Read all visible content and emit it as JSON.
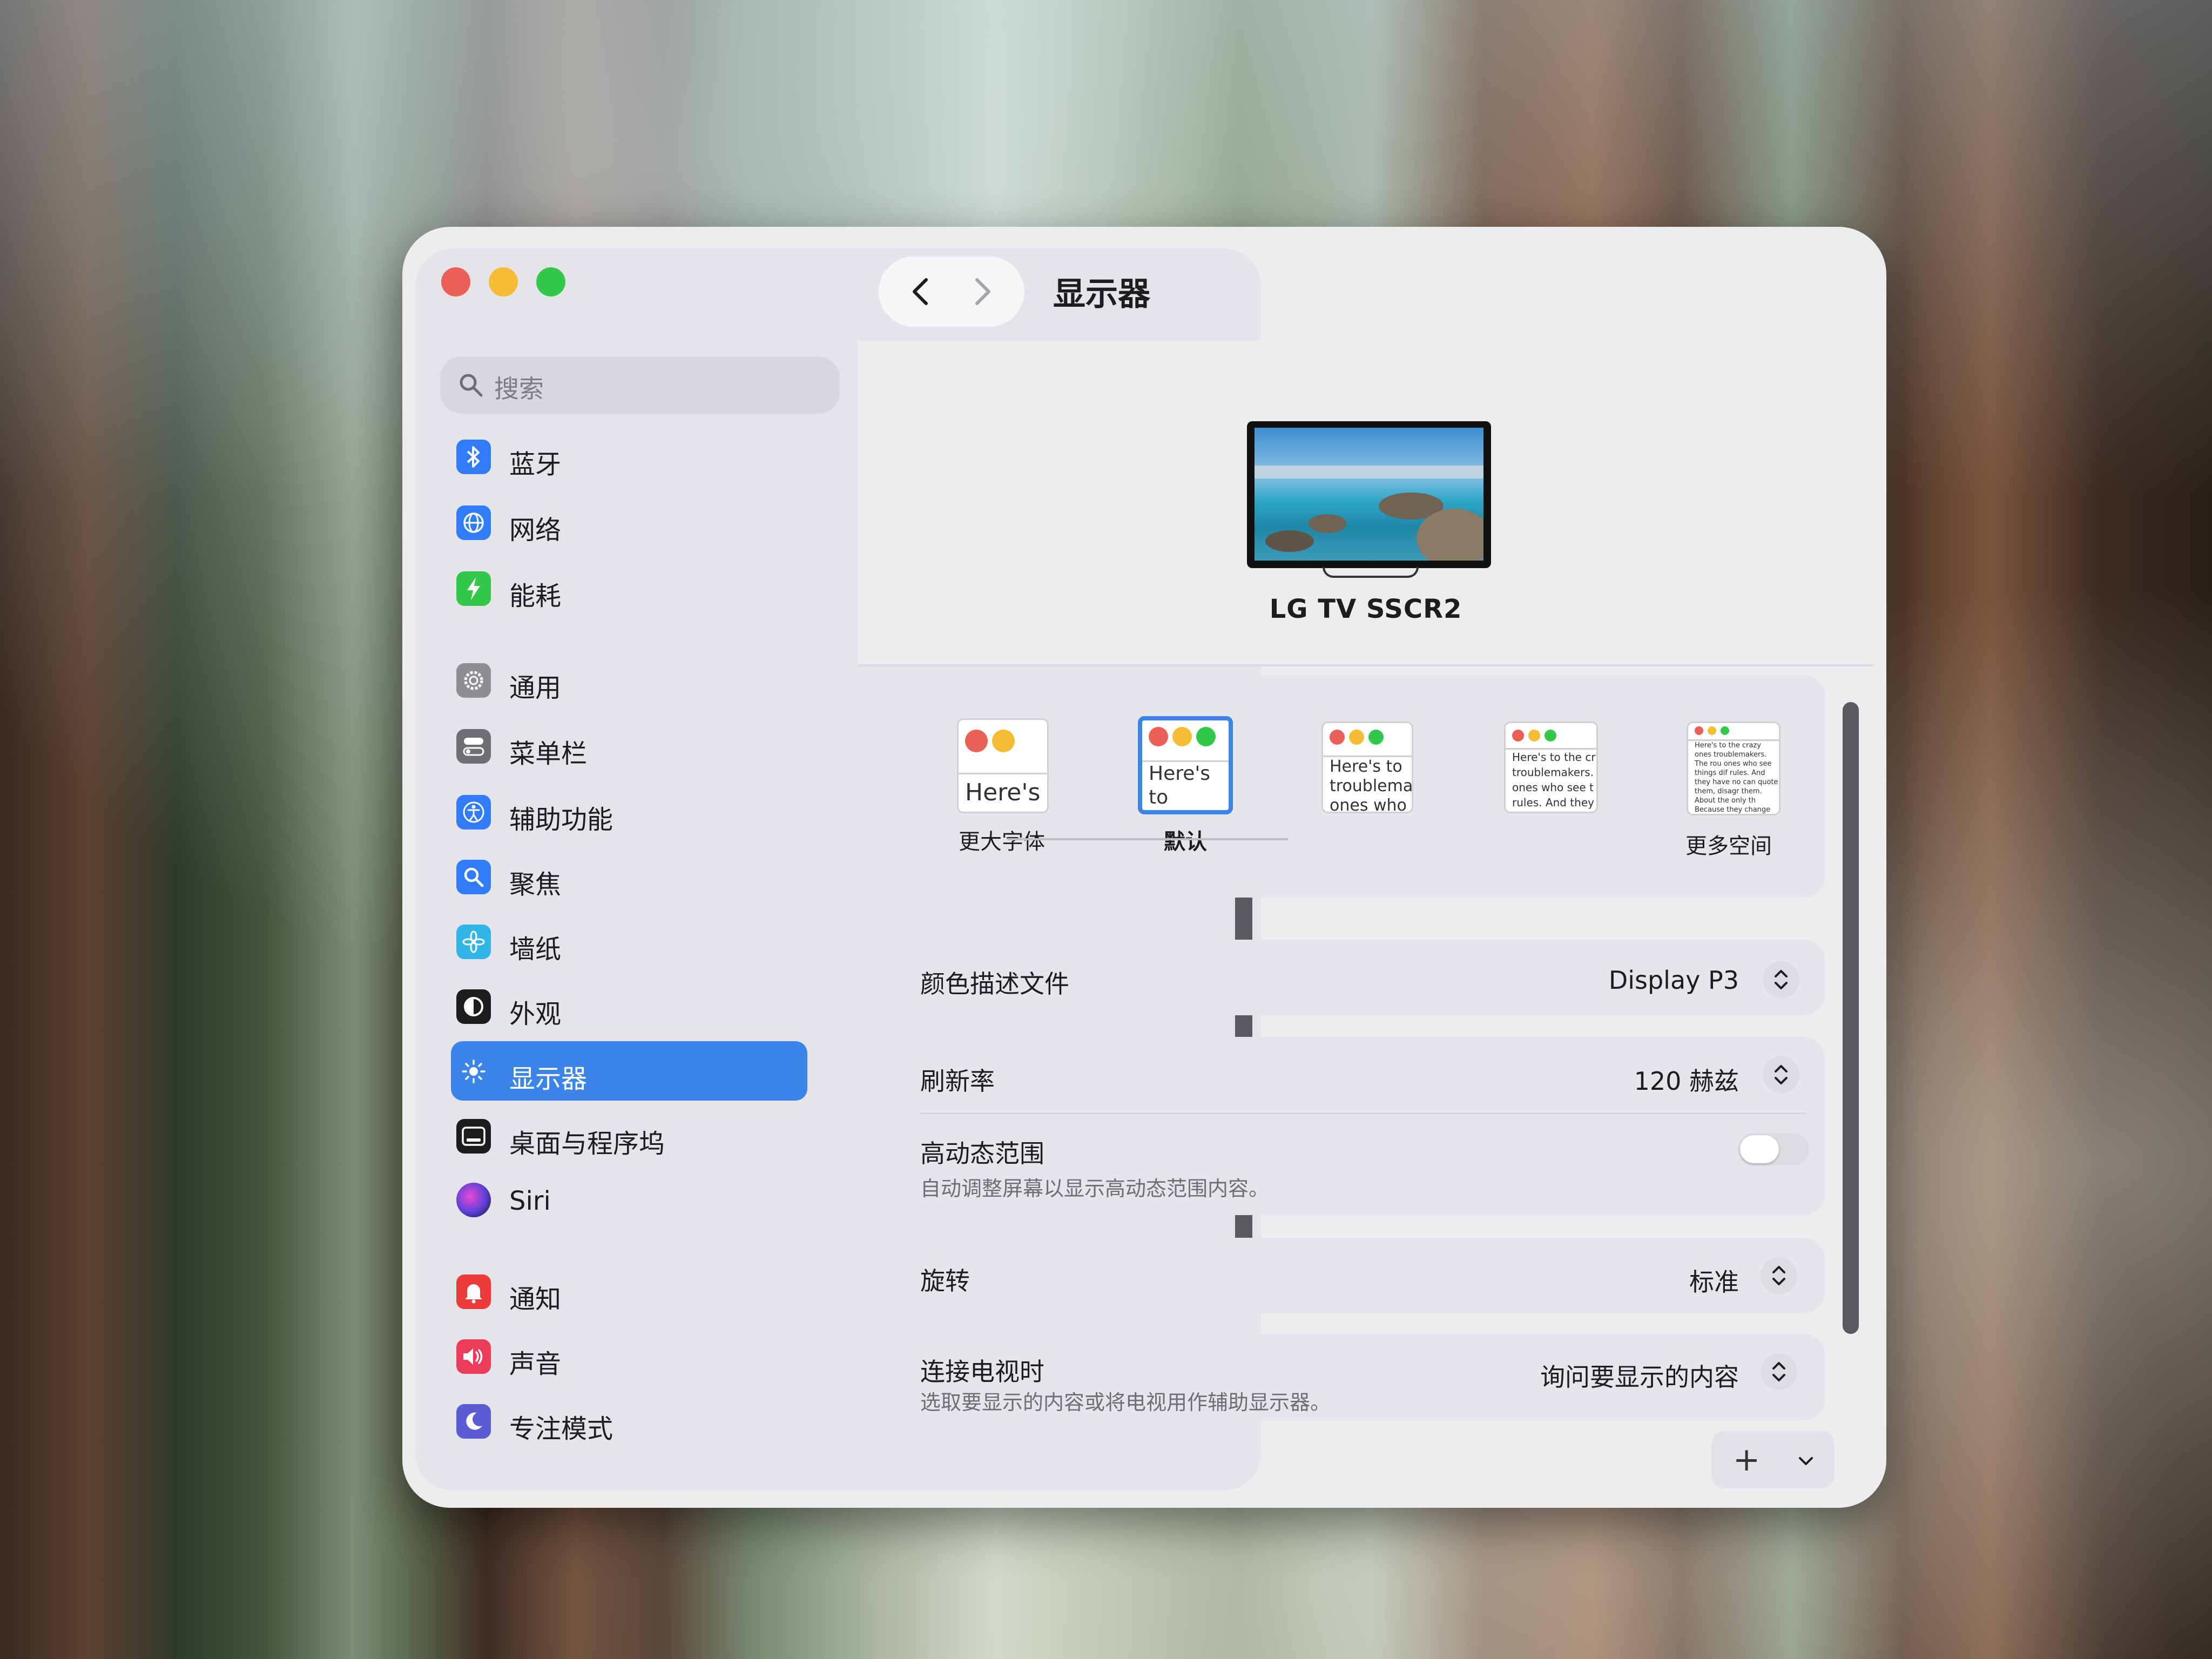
{
  "window": {
    "title": "显示器"
  },
  "search": {
    "placeholder": "搜索"
  },
  "sidebar": {
    "items": [
      {
        "label": "蓝牙",
        "icon": "bluetooth-icon",
        "color": "#2f7cf6"
      },
      {
        "label": "网络",
        "icon": "globe-icon",
        "color": "#2f7cf6"
      },
      {
        "label": "能耗",
        "icon": "battery-bolt-icon",
        "color": "#34c84a"
      },
      {
        "label": "通用",
        "icon": "gear-icon",
        "color": "#8e8e93"
      },
      {
        "label": "菜单栏",
        "icon": "toggles-icon",
        "color": "#6e6e73"
      },
      {
        "label": "辅助功能",
        "icon": "accessibility-icon",
        "color": "#2f7cf6"
      },
      {
        "label": "聚焦",
        "icon": "magnifier-icon",
        "color": "#2f7cf6"
      },
      {
        "label": "墙纸",
        "icon": "flower-icon",
        "color": "#33b4e6"
      },
      {
        "label": "外观",
        "icon": "appearance-icon",
        "color": "#1d1d1f"
      },
      {
        "label": "显示器",
        "icon": "sun-icon",
        "color": "#2f7cf6"
      },
      {
        "label": "桌面与程序坞",
        "icon": "dock-icon",
        "color": "#1d1d1f"
      },
      {
        "label": "Siri",
        "icon": "siri-icon",
        "color": "#5b3fd6"
      },
      {
        "label": "通知",
        "icon": "bell-icon",
        "color": "#ec3b3b"
      },
      {
        "label": "声音",
        "icon": "speaker-icon",
        "color": "#ec3b5a"
      },
      {
        "label": "专注模式",
        "icon": "moon-icon",
        "color": "#5b5bd6"
      }
    ],
    "active_label": "显示器"
  },
  "display": {
    "name": "LG TV SSCR2",
    "resolution_options": [
      {
        "label": "更大字体",
        "sample": "Here's"
      },
      {
        "label": "默认",
        "sample": "Here's to troublem"
      },
      {
        "label": "",
        "sample": "Here's to troublema ones who"
      },
      {
        "label": "",
        "sample": "Here's to the cr troublemakers. ones who see t rules. And they"
      },
      {
        "label": "更多空间",
        "sample": "Here's to the crazy ones troublemakers. The rou ones who see things dif rules. And they have no can quote them, disagr them. About the only th Because they change th"
      }
    ],
    "selected_resolution": "默认"
  },
  "settings": {
    "color_profile": {
      "label": "颜色描述文件",
      "value": "Display P3"
    },
    "refresh_rate": {
      "label": "刷新率",
      "value": "120 赫兹"
    },
    "hdr": {
      "label": "高动态范围",
      "description": "自动调整屏幕以显示高动态范围内容。",
      "enabled": false
    },
    "rotation": {
      "label": "旋转",
      "value": "标准"
    },
    "tv_connect": {
      "label": "连接电视时",
      "description": "选取要显示的内容或将电视用作辅助显示器。",
      "value": "询问要显示的内容"
    }
  },
  "footer": {
    "add_label": "+"
  },
  "colors": {
    "accent": "#3d84e8",
    "close": "#ec5f56",
    "minimize": "#f4bd33",
    "zoom": "#34c84a"
  }
}
